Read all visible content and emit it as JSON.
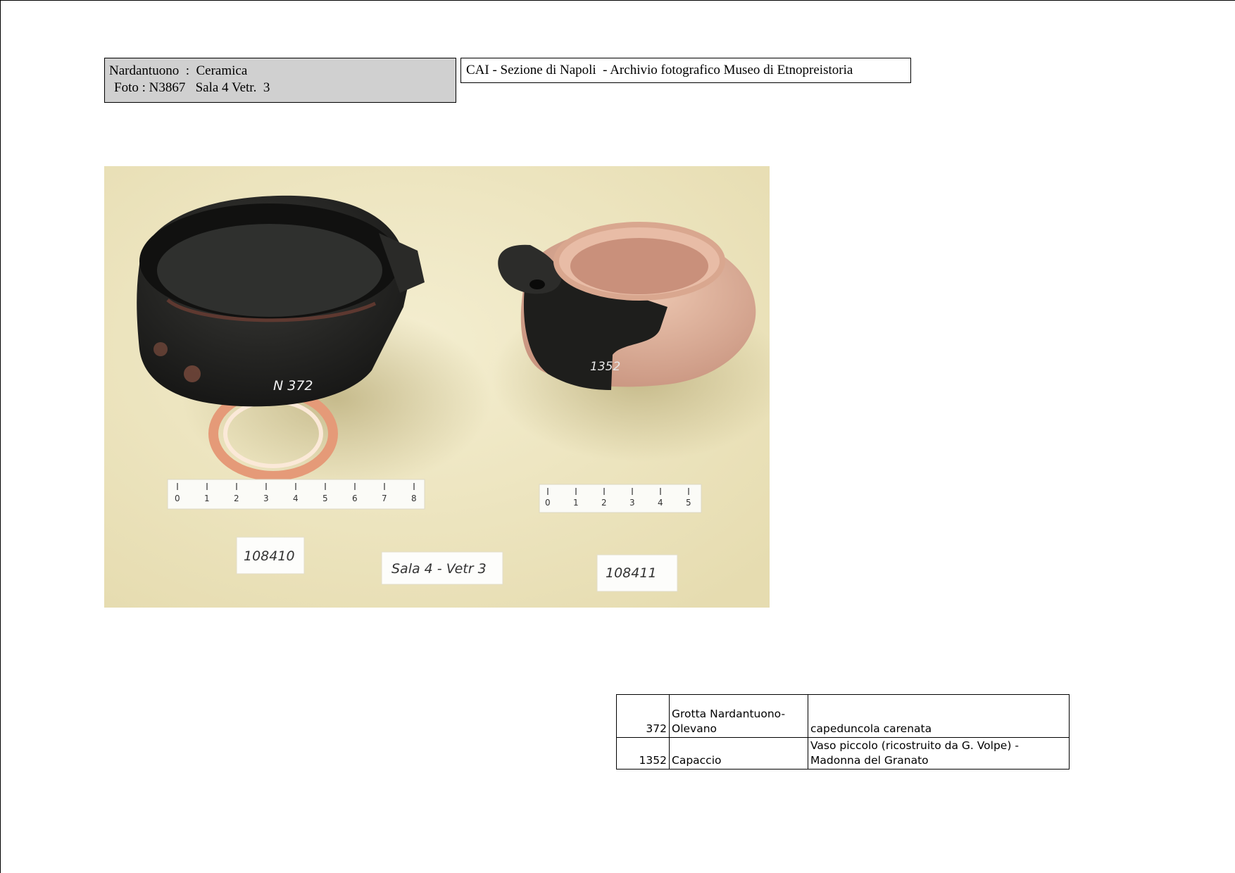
{
  "title_box": {
    "line1": "Nardantuono  :  Ceramica",
    "line2": "Foto : N3867   Sala 4 Vetr.  3"
  },
  "header_box": {
    "text": "CAI - Sezione di Napoli  - Archivio fotografico Museo di Etnopreistoria"
  },
  "photo": {
    "left_vessel_mark": "N 372",
    "right_vessel_mark": "1352",
    "left_card": "108410",
    "center_card": "Sala 4 - Vetr 3",
    "right_card": "108411",
    "left_ruler_ticks": [
      "0",
      "1",
      "2",
      "3",
      "4",
      "5",
      "6",
      "7",
      "8"
    ],
    "right_ruler_ticks": [
      "0",
      "1",
      "2",
      "3",
      "4",
      "5"
    ]
  },
  "catalog": {
    "rows": [
      {
        "number": "372",
        "location": "Grotta Nardantuono-Olevano",
        "description": "capeduncola carenata"
      },
      {
        "number": "1352",
        "location": "Capaccio",
        "description": "Vaso piccolo (ricostruito da G. Volpe) - Madonna del Granato"
      }
    ]
  },
  "colors": {
    "photo_background": "#efe8c4",
    "title_box_fill": "#d0d0d0",
    "black_vessel": "#1e1e1c",
    "terracotta_vessel": "#e2b39c"
  }
}
